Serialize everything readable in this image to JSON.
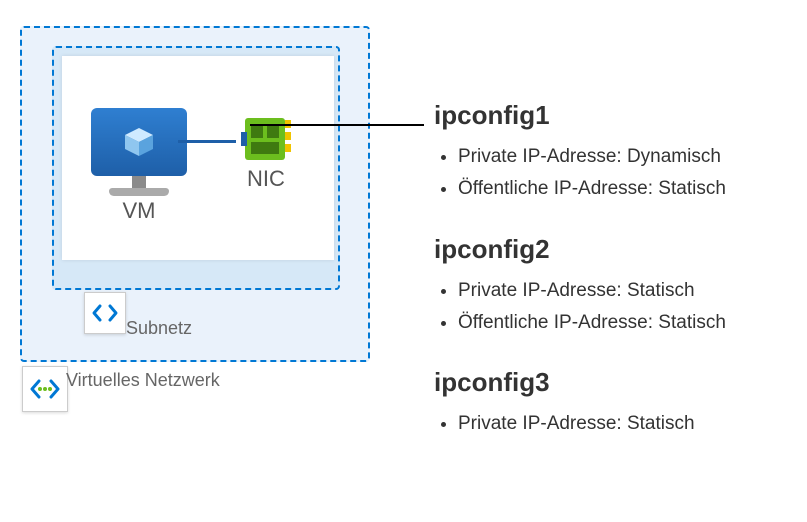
{
  "diagram": {
    "vnet_label": "Virtuelles Netzwerk",
    "subnet_label": "Subnetz",
    "vm_label": "VM",
    "nic_label": "NIC"
  },
  "icons": {
    "vm": "vm-icon",
    "nic": "nic-icon",
    "subnet": "subnet-icon",
    "vnet": "vnet-icon"
  },
  "colors": {
    "azure_blue": "#0078d4",
    "nic_green": "#6cbe1e",
    "nic_yellow": "#f0c400"
  },
  "configs": [
    {
      "title": "ipconfig1",
      "items": [
        "Private IP-Adresse: Dynamisch",
        "Öffentliche IP-Adresse: Statisch"
      ]
    },
    {
      "title": "ipconfig2",
      "items": [
        "Private IP-Adresse: Statisch",
        "Öffentliche IP-Adresse: Statisch"
      ]
    },
    {
      "title": "ipconfig3",
      "items": [
        "Private IP-Adresse: Statisch"
      ]
    }
  ]
}
